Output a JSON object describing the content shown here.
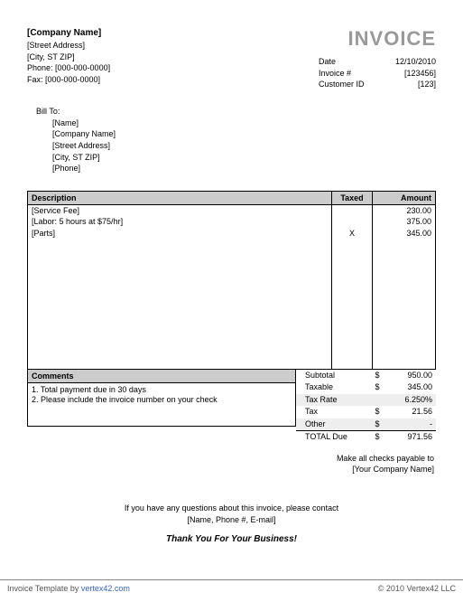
{
  "company": {
    "name": "[Company Name]",
    "street": "[Street Address]",
    "city": "[City, ST  ZIP]",
    "phone": "Phone: [000-000-0000]",
    "fax": "Fax: [000-000-0000]"
  },
  "invoice": {
    "title": "INVOICE",
    "date_label": "Date",
    "date": "12/10/2010",
    "number_label": "Invoice #",
    "number": "[123456]",
    "customer_label": "Customer ID",
    "customer": "[123]"
  },
  "billto": {
    "title": "Bill To:",
    "name": "[Name]",
    "company": "[Company Name]",
    "street": "[Street Address]",
    "city": "[City, ST  ZIP]",
    "phone": "[Phone]"
  },
  "headers": {
    "description": "Description",
    "taxed": "Taxed",
    "amount": "Amount"
  },
  "items": [
    {
      "desc": "[Service Fee]",
      "taxed": "",
      "amount": "230.00"
    },
    {
      "desc": "[Labor: 5 hours at $75/hr]",
      "taxed": "",
      "amount": "375.00"
    },
    {
      "desc": "[Parts]",
      "taxed": "X",
      "amount": "345.00"
    }
  ],
  "comments": {
    "header": "Comments",
    "line1": "1. Total payment due in 30 days",
    "line2": "2. Please include the invoice number on your check"
  },
  "totals": {
    "subtotal_label": "Subtotal",
    "subtotal": "950.00",
    "taxable_label": "Taxable",
    "taxable": "345.00",
    "taxrate_label": "Tax Rate",
    "taxrate": "6.250%",
    "tax_label": "Tax",
    "tax": "21.56",
    "other_label": "Other",
    "other": "-",
    "totaldue_label": "TOTAL Due",
    "totaldue": "971.56",
    "currency": "$"
  },
  "payable": {
    "line1": "Make all checks payable to",
    "line2": "[Your Company Name]"
  },
  "contact": {
    "line1": "If you have any questions about this invoice, please contact",
    "line2": "[Name, Phone #, E-mail]"
  },
  "thanks": "Thank You For Your Business!",
  "footer": {
    "left_text": "Invoice Template by ",
    "link": "vertex42.com",
    "right": "© 2010 Vertex42 LLC"
  }
}
